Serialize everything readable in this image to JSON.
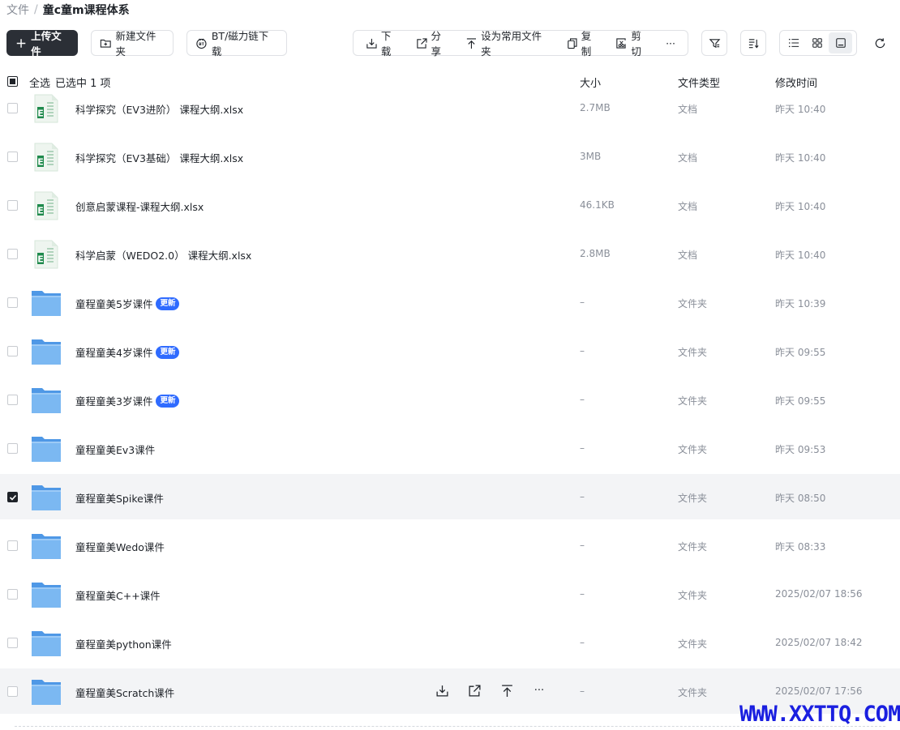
{
  "breadcrumb": {
    "root": "文件",
    "separator": "/",
    "current": "童c童m课程体系"
  },
  "toolbar": {
    "upload": "上传文件",
    "new_folder": "新建文件夹",
    "bt_download": "BT/磁力链下载",
    "download": "下载",
    "share": "分享",
    "set_common": "设为常用文件夹",
    "copy": "复制",
    "cut": "剪切",
    "more": "···"
  },
  "header": {
    "select_all": "全选",
    "selected": "已选中 1 项",
    "size": "大小",
    "type": "文件类型",
    "modified": "修改时间"
  },
  "rows": [
    {
      "name": "科学探究（EV3进阶） 课程大纲.xlsx",
      "kind": "xlsx",
      "size": "2.7MB",
      "type": "文档",
      "time": "昨天 10:40",
      "badge": ""
    },
    {
      "name": "科学探究（EV3基础） 课程大纲.xlsx",
      "kind": "xlsx",
      "size": "3MB",
      "type": "文档",
      "time": "昨天 10:40",
      "badge": ""
    },
    {
      "name": "创意启蒙课程-课程大纲.xlsx",
      "kind": "xlsx",
      "size": "46.1KB",
      "type": "文档",
      "time": "昨天 10:40",
      "badge": ""
    },
    {
      "name": "科学启蒙（WEDO2.0） 课程大纲.xlsx",
      "kind": "xlsx",
      "size": "2.8MB",
      "type": "文档",
      "time": "昨天 10:40",
      "badge": ""
    },
    {
      "name": "童程童美5岁课件",
      "kind": "folder",
      "size": "–",
      "type": "文件夹",
      "time": "昨天 10:39",
      "badge": "更新"
    },
    {
      "name": "童程童美4岁课件",
      "kind": "folder",
      "size": "–",
      "type": "文件夹",
      "time": "昨天 09:55",
      "badge": "更新"
    },
    {
      "name": "童程童美3岁课件",
      "kind": "folder",
      "size": "–",
      "type": "文件夹",
      "time": "昨天 09:55",
      "badge": "更新"
    },
    {
      "name": "童程童美Ev3课件",
      "kind": "folder",
      "size": "–",
      "type": "文件夹",
      "time": "昨天 09:53",
      "badge": ""
    },
    {
      "name": "童程童美Spike课件",
      "kind": "folder",
      "size": "–",
      "type": "文件夹",
      "time": "昨天 08:50",
      "badge": "",
      "checked": true
    },
    {
      "name": "童程童美Wedo课件",
      "kind": "folder",
      "size": "–",
      "type": "文件夹",
      "time": "昨天 08:33",
      "badge": ""
    },
    {
      "name": "童程童美C++课件",
      "kind": "folder",
      "size": "–",
      "type": "文件夹",
      "time": "2025/02/07 18:56",
      "badge": ""
    },
    {
      "name": "童程童美python课件",
      "kind": "folder",
      "size": "–",
      "type": "文件夹",
      "time": "2025/02/07 18:42",
      "badge": ""
    },
    {
      "name": "童程童美Scratch课件",
      "kind": "folder",
      "size": "–",
      "type": "文件夹",
      "time": "2025/02/07 17:56",
      "badge": "",
      "hover": true
    }
  ],
  "hover_actions": {
    "more": "···"
  },
  "watermark": "WWW.XXTTQ.COM",
  "colors": {
    "primary_dark": "#2b2f36",
    "badge_blue": "#2f6bff",
    "folder_blue": "#6aaef0",
    "excel_green": "#1f8a4c",
    "watermark": "#1a1fe0"
  }
}
